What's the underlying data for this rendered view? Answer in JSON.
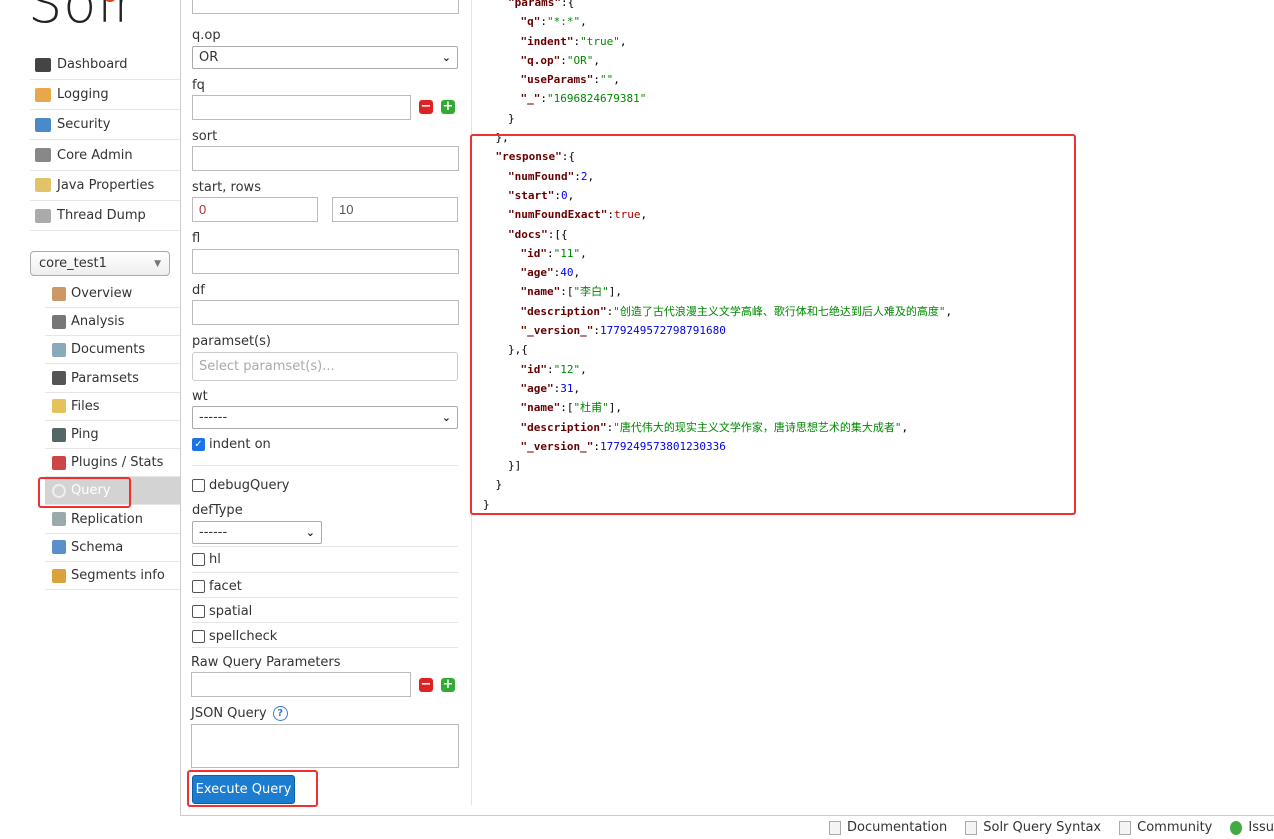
{
  "logo": "Solr",
  "nav": [
    {
      "label": "Dashboard",
      "icon": "dashboard-icon"
    },
    {
      "label": "Logging",
      "icon": "logging-icon"
    },
    {
      "label": "Security",
      "icon": "security-icon"
    },
    {
      "label": "Core Admin",
      "icon": "core-admin-icon"
    },
    {
      "label": "Java Properties",
      "icon": "java-properties-icon"
    },
    {
      "label": "Thread Dump",
      "icon": "thread-dump-icon"
    }
  ],
  "core_selector": "core_test1",
  "core_nav": [
    {
      "label": "Overview"
    },
    {
      "label": "Analysis"
    },
    {
      "label": "Documents"
    },
    {
      "label": "Paramsets"
    },
    {
      "label": "Files"
    },
    {
      "label": "Ping"
    },
    {
      "label": "Plugins / Stats"
    },
    {
      "label": "Query",
      "active": true
    },
    {
      "label": "Replication"
    },
    {
      "label": "Schema"
    },
    {
      "label": "Segments info"
    }
  ],
  "form": {
    "qop_label": "q.op",
    "qop_value": "OR",
    "fq_label": "fq",
    "sort_label": "sort",
    "start_rows_label": "start, rows",
    "start_value": "0",
    "rows_value": "10",
    "fl_label": "fl",
    "df_label": "df",
    "paramset_label": "paramset(s)",
    "paramset_placeholder": "Select paramset(s)...",
    "wt_label": "wt",
    "wt_value": "------",
    "indent_label": "indent on",
    "indent_checked": true,
    "debug_label": "debugQuery",
    "deftype_label": "defType",
    "deftype_value": "------",
    "hl_label": "hl",
    "facet_label": "facet",
    "spatial_label": "spatial",
    "spellcheck_label": "spellcheck",
    "raw_label": "Raw Query Parameters",
    "json_label": "JSON Query",
    "execute_label": "Execute Query"
  },
  "response_lines": [
    [
      2,
      [
        [
          "k",
          "\"params\""
        ],
        [
          "p",
          ":{"
        ]
      ]
    ],
    [
      3,
      [
        [
          "k",
          "\"q\""
        ],
        [
          "p",
          ":"
        ],
        [
          "s",
          "\"*:*\""
        ],
        [
          "p",
          ","
        ]
      ]
    ],
    [
      3,
      [
        [
          "k",
          "\"indent\""
        ],
        [
          "p",
          ":"
        ],
        [
          "s",
          "\"true\""
        ],
        [
          "p",
          ","
        ]
      ]
    ],
    [
      3,
      [
        [
          "k",
          "\"q.op\""
        ],
        [
          "p",
          ":"
        ],
        [
          "s",
          "\"OR\""
        ],
        [
          "p",
          ","
        ]
      ]
    ],
    [
      3,
      [
        [
          "k",
          "\"useParams\""
        ],
        [
          "p",
          ":"
        ],
        [
          "s",
          "\"\""
        ],
        [
          "p",
          ","
        ]
      ]
    ],
    [
      3,
      [
        [
          "k",
          "\"_\""
        ],
        [
          "p",
          ":"
        ],
        [
          "s",
          "\"1696824679381\""
        ]
      ]
    ],
    [
      2,
      [
        [
          "p",
          "}"
        ]
      ]
    ],
    [
      1,
      [
        [
          "p",
          "},"
        ]
      ]
    ],
    [
      1,
      [
        [
          "k",
          "\"response\""
        ],
        [
          "p",
          ":{"
        ]
      ]
    ],
    [
      2,
      [
        [
          "k",
          "\"numFound\""
        ],
        [
          "p",
          ":"
        ],
        [
          "n",
          "2"
        ],
        [
          "p",
          ","
        ]
      ]
    ],
    [
      2,
      [
        [
          "k",
          "\"start\""
        ],
        [
          "p",
          ":"
        ],
        [
          "n",
          "0"
        ],
        [
          "p",
          ","
        ]
      ]
    ],
    [
      2,
      [
        [
          "k",
          "\"numFoundExact\""
        ],
        [
          "p",
          ":"
        ],
        [
          "b",
          "true"
        ],
        [
          "p",
          ","
        ]
      ]
    ],
    [
      2,
      [
        [
          "k",
          "\"docs\""
        ],
        [
          "p",
          ":[{"
        ]
      ]
    ],
    [
      3,
      [
        [
          "k",
          "\"id\""
        ],
        [
          "p",
          ":"
        ],
        [
          "s",
          "\"11\""
        ],
        [
          "p",
          ","
        ]
      ]
    ],
    [
      3,
      [
        [
          "k",
          "\"age\""
        ],
        [
          "p",
          ":"
        ],
        [
          "n",
          "40"
        ],
        [
          "p",
          ","
        ]
      ]
    ],
    [
      3,
      [
        [
          "k",
          "\"name\""
        ],
        [
          "p",
          ":["
        ],
        [
          "s",
          "\"李白\""
        ],
        [
          "p",
          "],"
        ]
      ]
    ],
    [
      3,
      [
        [
          "k",
          "\"description\""
        ],
        [
          "p",
          ":"
        ],
        [
          "s",
          "\"创造了古代浪漫主义文学高峰、歌行体和七绝达到后人难及的高度\""
        ],
        [
          "p",
          ","
        ]
      ]
    ],
    [
      3,
      [
        [
          "k",
          "\"_version_\""
        ],
        [
          "p",
          ":"
        ],
        [
          "n",
          "1779249572798791680"
        ]
      ]
    ],
    [
      2,
      [
        [
          "p",
          "},{"
        ]
      ]
    ],
    [
      3,
      [
        [
          "k",
          "\"id\""
        ],
        [
          "p",
          ":"
        ],
        [
          "s",
          "\"12\""
        ],
        [
          "p",
          ","
        ]
      ]
    ],
    [
      3,
      [
        [
          "k",
          "\"age\""
        ],
        [
          "p",
          ":"
        ],
        [
          "n",
          "31"
        ],
        [
          "p",
          ","
        ]
      ]
    ],
    [
      3,
      [
        [
          "k",
          "\"name\""
        ],
        [
          "p",
          ":["
        ],
        [
          "s",
          "\"杜甫\""
        ],
        [
          "p",
          "],"
        ]
      ]
    ],
    [
      3,
      [
        [
          "k",
          "\"description\""
        ],
        [
          "p",
          ":"
        ],
        [
          "s",
          "\"唐代伟大的现实主义文学作家，唐诗思想艺术的集大成者\""
        ],
        [
          "p",
          ","
        ]
      ]
    ],
    [
      3,
      [
        [
          "k",
          "\"_version_\""
        ],
        [
          "p",
          ":"
        ],
        [
          "n",
          "1779249573801230336"
        ]
      ]
    ],
    [
      2,
      [
        [
          "p",
          "}]"
        ]
      ]
    ],
    [
      1,
      [
        [
          "p",
          "}"
        ]
      ]
    ],
    [
      0,
      [
        [
          "p",
          "}"
        ]
      ]
    ]
  ],
  "footer": [
    {
      "label": "Documentation",
      "icon": "documentation-icon"
    },
    {
      "label": "Solr Query Syntax",
      "icon": "query-syntax-icon"
    },
    {
      "label": "Community",
      "icon": "mail-icon"
    },
    {
      "label": "Issu",
      "icon": "bug-icon"
    }
  ],
  "colors": {
    "accent": "#1b7cd0",
    "highlight": "#f03030",
    "logo": "#d9411e"
  }
}
